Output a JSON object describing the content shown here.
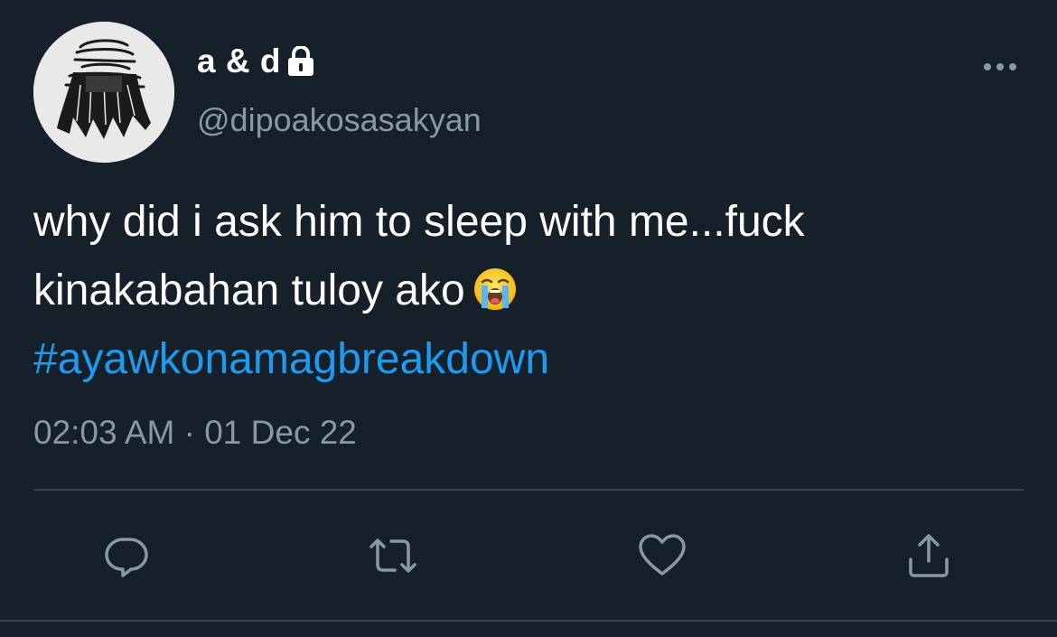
{
  "user": {
    "display_name": "a & d",
    "handle": "@dipoakosasakyan",
    "protected_icon": "lock-icon",
    "avatar_icon": "avatar-image"
  },
  "tweet": {
    "line1": "why did i ask him to sleep with me...fuck",
    "line2": "kinakabahan tuloy ako",
    "emoji": "loudly-crying-face-emoji",
    "hashtag": "#ayawkonamagbreakdown",
    "timestamp": "02:03 AM · 01 Dec 22"
  },
  "actions": {
    "reply_icon": "reply-icon",
    "retweet_icon": "retweet-icon",
    "like_icon": "heart-icon",
    "share_icon": "share-icon"
  },
  "menu": {
    "more_icon": "more-options-icon"
  },
  "colors": {
    "background": "#15202b",
    "text": "#ffffff",
    "secondary": "#8899a6",
    "link": "#1d9bf0",
    "divider": "#38444d"
  }
}
